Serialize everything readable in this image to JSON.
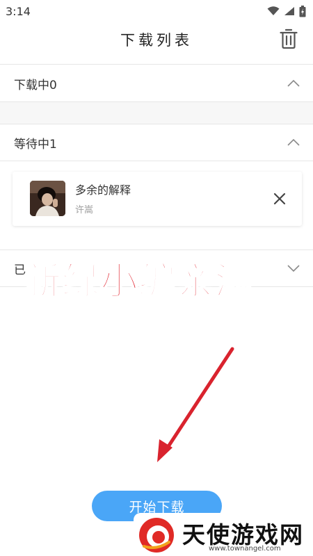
{
  "status_bar": {
    "time": "3:14"
  },
  "header": {
    "title": "下载列表"
  },
  "sections": {
    "downloading": {
      "label": "下载中0"
    },
    "waiting": {
      "label": "等待中1"
    },
    "completed": {
      "label": "已"
    }
  },
  "task": {
    "title": "多余的解释",
    "artist": "许嵩"
  },
  "overlay": {
    "caption": "新绿小编亲测"
  },
  "start_button": {
    "label": "开始下载"
  },
  "watermark": {
    "name": "天使游戏网",
    "url": "www.townangel.com"
  },
  "colors": {
    "accent_blue": "#4aa6f7",
    "overlay_red": "#e0212d",
    "arrow_red": "#d9232e"
  }
}
